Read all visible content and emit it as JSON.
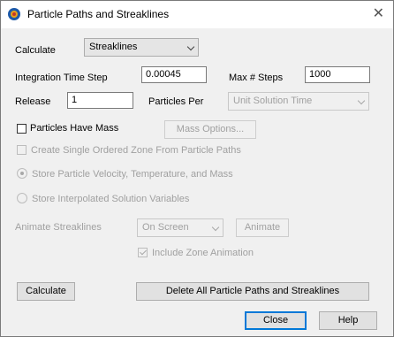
{
  "window": {
    "title": "Particle Paths and Streaklines"
  },
  "calculate_row": {
    "label": "Calculate",
    "mode_value": "Streaklines"
  },
  "integration": {
    "label": "Integration Time Step",
    "value": "0.00045"
  },
  "max_steps": {
    "label": "Max # Steps",
    "value": "1000"
  },
  "release": {
    "label": "Release",
    "value": "1"
  },
  "particles_per": {
    "label": "Particles Per",
    "value": "Unit Solution Time"
  },
  "mass": {
    "label": "Particles Have Mass",
    "checked": false,
    "options_button": "Mass Options..."
  },
  "single_zone": {
    "label": "Create Single Ordered Zone From Particle Paths",
    "checked": false
  },
  "store_velocity": {
    "label": "Store Particle Velocity, Temperature, and Mass",
    "selected": true
  },
  "store_interpolated": {
    "label": "Store Interpolated Solution Variables",
    "selected": false
  },
  "animate": {
    "label": "Animate Streaklines",
    "mode_value": "On Screen",
    "button": "Animate"
  },
  "zone_animation": {
    "label": "Include Zone Animation",
    "checked": true
  },
  "actions": {
    "calculate": "Calculate",
    "delete_all": "Delete All Particle Paths and Streaklines"
  },
  "footer": {
    "close": "Close",
    "help": "Help"
  },
  "icons": {
    "app": "tecplot-app-icon",
    "close": "close-icon",
    "dropdown": "chevron-down-icon"
  },
  "colors": {
    "accent": "#0078d7",
    "disabled_text": "#a0a0a0"
  }
}
